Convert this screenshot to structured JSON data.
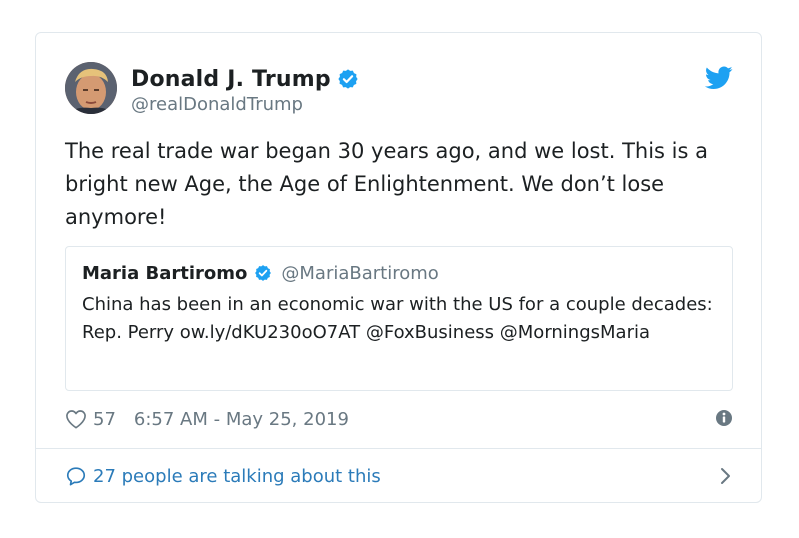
{
  "tweet": {
    "display_name": "Donald J. Trump",
    "handle": "@realDonaldTrump",
    "text": "The real trade war began 30 years ago, and we lost. This is a bright new Age, the Age of Enlightenment. We don’t lose anymore!",
    "likes": "57",
    "timestamp": "6:57 AM - May 25, 2019",
    "talking": "27 people are talking about this"
  },
  "quote": {
    "display_name": "Maria Bartiromo",
    "handle": "@MariaBartiromo",
    "text": "China has been in an economic war with the US for a couple decades: Rep. Perry ow.ly/dKU230oO7AT @FoxBusiness @MorningsMaria"
  },
  "icons": {
    "verified": "verified-badge-icon",
    "twitter": "twitter-bird-icon",
    "like": "heart-icon",
    "info": "info-icon",
    "reply": "speech-bubble-icon",
    "chevron": "chevron-right-icon"
  },
  "colors": {
    "verified_blue": "#1da1f2",
    "link_blue": "#2b7bb9",
    "secondary_text": "#697882",
    "border": "#e1e8ed"
  }
}
